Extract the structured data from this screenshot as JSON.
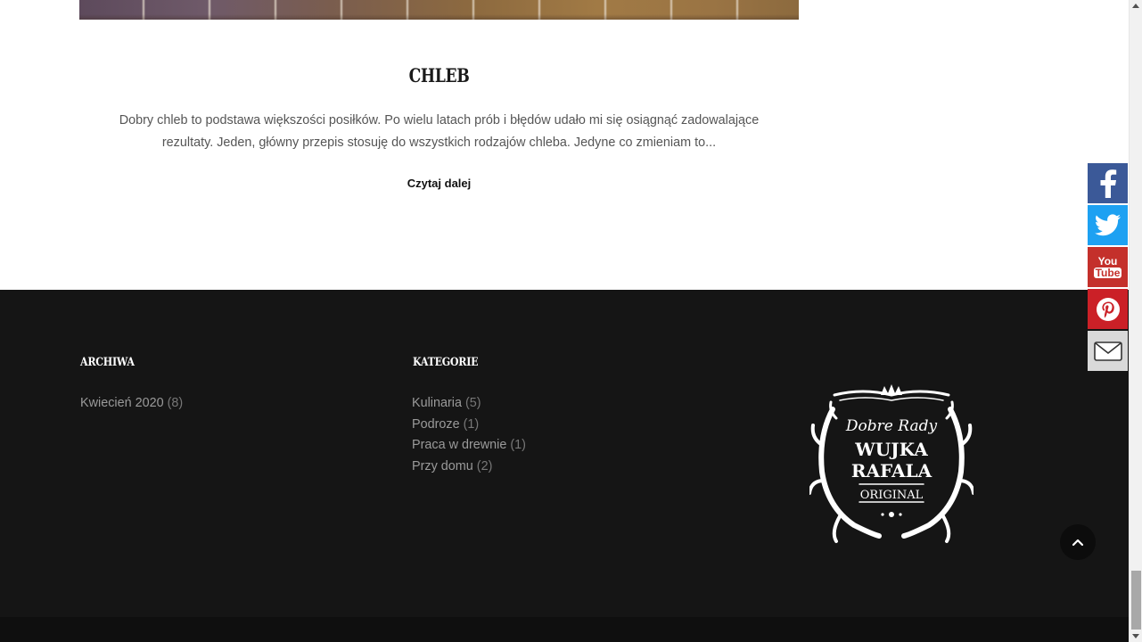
{
  "post": {
    "title": "CHLEB",
    "excerpt": "Dobry chleb to podstawa większości posiłków. Po wielu latach prób i błędów udało mi się osiągnąć zadowalające rezultaty. Jeden, główny przepis stosuję do wszystkich rodzajów chleba. Jedyne co zmieniam to...",
    "read_more": "Czytaj dalej"
  },
  "footer": {
    "archives": {
      "title": "ARCHIWA",
      "items": [
        {
          "label": "Kwiecień 2020",
          "count": "(8)"
        }
      ]
    },
    "categories": {
      "title": "KATEGORIE",
      "items": [
        {
          "label": "Kulinaria",
          "count": "(5)"
        },
        {
          "label": "Podroze",
          "count": "(1)"
        },
        {
          "label": "Praca w drewnie",
          "count": "(1)"
        },
        {
          "label": "Przy domu",
          "count": "(2)"
        }
      ]
    },
    "logo": {
      "line1": "Dobre Rady",
      "line2": "WUJKA",
      "line3": "RAFALA",
      "line4": "ORIGINAL"
    }
  },
  "social": {
    "items": [
      {
        "name": "facebook",
        "icon": "facebook-icon",
        "color": "#3b5998"
      },
      {
        "name": "twitter",
        "icon": "twitter-icon",
        "color": "#1da1f2"
      },
      {
        "name": "youtube",
        "icon": "youtube-icon",
        "color": "#c4302b",
        "glyph_top": "You",
        "glyph_bottom": "Tube"
      },
      {
        "name": "pinterest",
        "icon": "pinterest-icon",
        "color": "#cb2027"
      },
      {
        "name": "email",
        "icon": "email-icon",
        "color": "#d9d9d9"
      }
    ]
  },
  "colors": {
    "footer_bg": "#151515",
    "link_gray": "#9a9a9a"
  }
}
